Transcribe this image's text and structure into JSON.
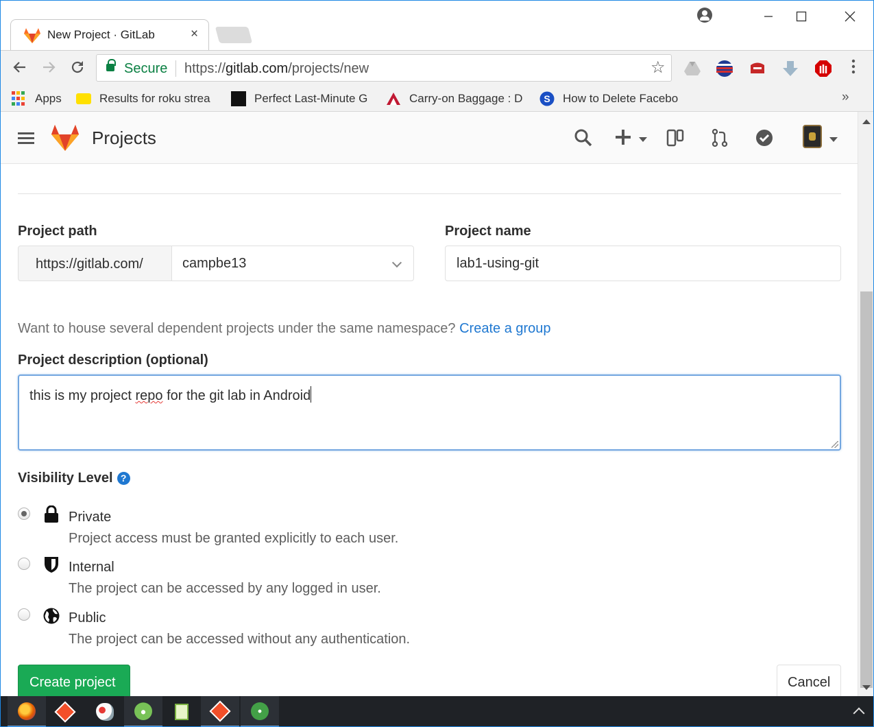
{
  "browser": {
    "tab_title": "New Project · GitLab",
    "tab_close": "×",
    "security_label": "Secure",
    "url_scheme": "https://",
    "url_host": "gitlab.com",
    "url_path": "/projects/new",
    "bookmarks": [
      {
        "label": "Apps",
        "icon": "apps-grid-icon"
      },
      {
        "label": "Results for roku strea",
        "icon": "bestbuy-icon"
      },
      {
        "label": "Perfect Last-Minute G",
        "icon": "digg-icon"
      },
      {
        "label": "Carry-on Baggage : D",
        "icon": "delta-icon"
      },
      {
        "label": "How to Delete Facebo",
        "icon": "s-icon"
      }
    ],
    "bookmarks_overflow": "»"
  },
  "gitlab": {
    "header_title": "Projects"
  },
  "form": {
    "project_path_label": "Project path",
    "path_prefix": "https://gitlab.com/",
    "namespace_value": "campbe13",
    "project_name_label": "Project name",
    "project_name_value": "lab1-using-git",
    "group_help_text": "Want to house several dependent projects under the same namespace?",
    "group_link": "Create a group",
    "description_label": "Project description (optional)",
    "description_before": "this is my project ",
    "description_misspelled": "repo",
    "description_after": " for the git lab in Android",
    "visibility_label": "Visibility Level",
    "help_glyph": "?",
    "visibility_options": [
      {
        "title": "Private",
        "desc": "Project access must be granted explicitly to each user.",
        "icon": "lock-icon",
        "selected": true
      },
      {
        "title": "Internal",
        "desc": "The project can be accessed by any logged in user.",
        "icon": "shield-icon",
        "selected": false
      },
      {
        "title": "Public",
        "desc": "The project can be accessed without any authentication.",
        "icon": "globe-icon",
        "selected": false
      }
    ],
    "create_button": "Create project",
    "cancel_button": "Cancel"
  },
  "colors": {
    "gitlab_orange": "#fc6d26",
    "primary_green": "#1aaa55",
    "link_blue": "#1f78d1",
    "secure_green": "#0b8043"
  }
}
